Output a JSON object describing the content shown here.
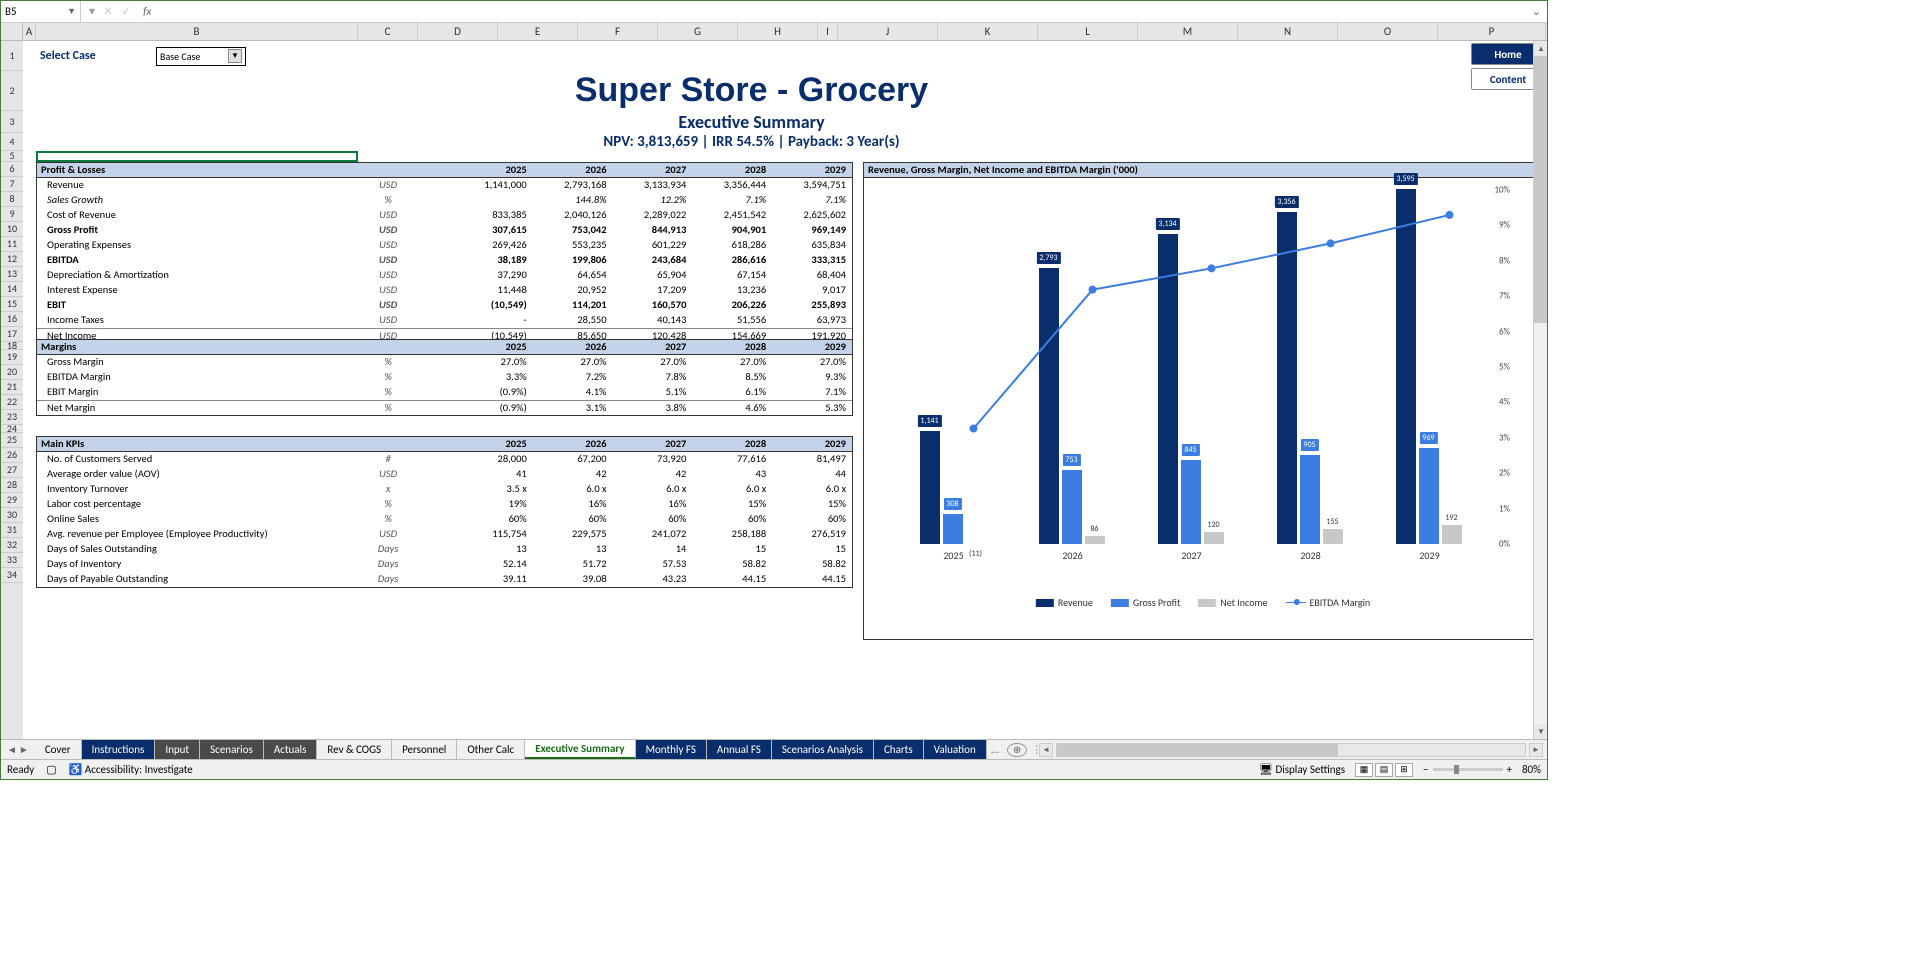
{
  "name_box": "B5",
  "fx": "fx",
  "formula_value": "",
  "select_case": {
    "label": "Select Case",
    "value": "Base Case"
  },
  "nav": {
    "home": "Home",
    "content": "Content"
  },
  "title": {
    "main": "Super Store - Grocery",
    "sub": "Executive Summary",
    "metrics": "NPV: 3,813,659 | IRR 54.5% | Payback: 3 Year(s)"
  },
  "columns": [
    "A",
    "B",
    "C",
    "D",
    "E",
    "F",
    "G",
    "H",
    "I",
    "J",
    "K",
    "L",
    "M",
    "N",
    "O",
    "P"
  ],
  "row_nums": [
    "1",
    "2",
    "3",
    "4",
    "5",
    "6",
    "7",
    "8",
    "9",
    "10",
    "11",
    "12",
    "13",
    "14",
    "15",
    "16",
    "17",
    "18",
    "19",
    "20",
    "21",
    "22",
    "23",
    "24",
    "25",
    "26",
    "27",
    "28",
    "29",
    "30",
    "31",
    "32",
    "33",
    "34"
  ],
  "years": [
    "2025",
    "2026",
    "2027",
    "2028",
    "2029"
  ],
  "pl": {
    "header": "Profit & Losses",
    "rows": [
      {
        "label": "Revenue",
        "unit": "USD",
        "vals": [
          "1,141,000",
          "2,793,168",
          "3,133,934",
          "3,356,444",
          "3,594,751"
        ]
      },
      {
        "label": "Sales Growth",
        "unit": "%",
        "vals": [
          "",
          "144.8%",
          "12.2%",
          "7.1%",
          "7.1%"
        ],
        "italic": true
      },
      {
        "label": "Cost of Revenue",
        "unit": "USD",
        "vals": [
          "833,385",
          "2,040,126",
          "2,289,022",
          "2,451,542",
          "2,625,602"
        ]
      },
      {
        "label": "Gross Profit",
        "unit": "USD",
        "vals": [
          "307,615",
          "753,042",
          "844,913",
          "904,901",
          "969,149"
        ],
        "bold": true
      },
      {
        "label": "Operating Expenses",
        "unit": "USD",
        "vals": [
          "269,426",
          "553,235",
          "601,229",
          "618,286",
          "635,834"
        ]
      },
      {
        "label": "EBITDA",
        "unit": "USD",
        "vals": [
          "38,189",
          "199,806",
          "243,684",
          "286,616",
          "333,315"
        ],
        "bold": true
      },
      {
        "label": "Depreciation & Amortization",
        "unit": "USD",
        "vals": [
          "37,290",
          "64,654",
          "65,904",
          "67,154",
          "68,404"
        ]
      },
      {
        "label": "Interest Expense",
        "unit": "USD",
        "vals": [
          "11,448",
          "20,952",
          "17,209",
          "13,236",
          "9,017"
        ]
      },
      {
        "label": "EBIT",
        "unit": "USD",
        "vals": [
          "(10,549)",
          "114,201",
          "160,570",
          "206,226",
          "255,893"
        ],
        "bold": true
      },
      {
        "label": "Income Taxes",
        "unit": "USD",
        "vals": [
          "-",
          "28,550",
          "40,143",
          "51,556",
          "63,973"
        ]
      },
      {
        "label": "Net Income",
        "unit": "USD",
        "vals": [
          "(10,549)",
          "85,650",
          "120,428",
          "154,669",
          "191,920"
        ],
        "last": true
      }
    ]
  },
  "margins": {
    "header": "Margins",
    "rows": [
      {
        "label": "Gross Margin",
        "unit": "%",
        "vals": [
          "27.0%",
          "27.0%",
          "27.0%",
          "27.0%",
          "27.0%"
        ]
      },
      {
        "label": "EBITDA Margin",
        "unit": "%",
        "vals": [
          "3.3%",
          "7.2%",
          "7.8%",
          "8.5%",
          "9.3%"
        ]
      },
      {
        "label": "EBIT Margin",
        "unit": "%",
        "vals": [
          "(0.9%)",
          "4.1%",
          "5.1%",
          "6.1%",
          "7.1%"
        ]
      },
      {
        "label": "Net Margin",
        "unit": "%",
        "vals": [
          "(0.9%)",
          "3.1%",
          "3.8%",
          "4.6%",
          "5.3%"
        ],
        "last": true
      }
    ]
  },
  "kpis": {
    "header": "Main KPIs",
    "rows": [
      {
        "label": "No. of Customers Served",
        "unit": "#",
        "vals": [
          "28,000",
          "67,200",
          "73,920",
          "77,616",
          "81,497"
        ]
      },
      {
        "label": "Average order value (AOV)",
        "unit": "USD",
        "vals": [
          "41",
          "42",
          "42",
          "43",
          "44"
        ]
      },
      {
        "label": "Inventory Turnover",
        "unit": "x",
        "vals": [
          "3.5 x",
          "6.0 x",
          "6.0 x",
          "6.0 x",
          "6.0 x"
        ]
      },
      {
        "label": "Labor cost percentage",
        "unit": "%",
        "vals": [
          "19%",
          "16%",
          "16%",
          "15%",
          "15%"
        ]
      },
      {
        "label": "Online Sales",
        "unit": "%",
        "vals": [
          "60%",
          "60%",
          "60%",
          "60%",
          "60%"
        ]
      },
      {
        "label": "Avg. revenue per Employee (Employee Productivity)",
        "unit": "USD",
        "vals": [
          "115,754",
          "229,575",
          "241,072",
          "258,188",
          "276,519"
        ]
      },
      {
        "label": "Days of Sales Outstanding",
        "unit": "Days",
        "vals": [
          "13",
          "13",
          "14",
          "15",
          "15"
        ]
      },
      {
        "label": "Days of Inventory",
        "unit": "Days",
        "vals": [
          "52.14",
          "51.72",
          "57.53",
          "58.82",
          "58.82"
        ]
      },
      {
        "label": "Days of Payable Outstanding",
        "unit": "Days",
        "vals": [
          "39.11",
          "39.08",
          "43.23",
          "44.15",
          "44.15"
        ]
      }
    ]
  },
  "chart": {
    "title": "Revenue, Gross Margin, Net Income and EBITDA Margin ('000)",
    "y2_label": "EBITDA Margin",
    "y2_ticks": [
      "10%",
      "9%",
      "8%",
      "7%",
      "6%",
      "5%",
      "4%",
      "3%",
      "2%",
      "1%",
      "0%"
    ],
    "x": [
      "2025",
      "2026",
      "2027",
      "2028",
      "2029"
    ],
    "legend": [
      "Revenue",
      "Gross Profit",
      "Net Income",
      "EBITDA Margin"
    ],
    "bar_labels": {
      "rev": [
        "1,141",
        "2,793",
        "3,134",
        "3,356",
        "3,595"
      ],
      "gp": [
        "308",
        "753",
        "845",
        "905",
        "969"
      ],
      "ni": [
        "(11)",
        "86",
        "120",
        "155",
        "192"
      ]
    }
  },
  "chart_data": {
    "type": "bar",
    "title": "Revenue, Gross Margin, Net Income and EBITDA Margin ('000)",
    "categories": [
      "2025",
      "2026",
      "2027",
      "2028",
      "2029"
    ],
    "series": [
      {
        "name": "Revenue",
        "values": [
          1141,
          2793,
          3134,
          3356,
          3595
        ],
        "axis": "y1"
      },
      {
        "name": "Gross Profit",
        "values": [
          308,
          753,
          845,
          905,
          969
        ],
        "axis": "y1"
      },
      {
        "name": "Net Income",
        "values": [
          -11,
          86,
          120,
          155,
          192
        ],
        "axis": "y1"
      },
      {
        "name": "EBITDA Margin",
        "values": [
          3.3,
          7.2,
          7.8,
          8.5,
          9.3
        ],
        "type": "line",
        "axis": "y2",
        "unit": "%"
      }
    ],
    "y2label": "EBITDA Margin",
    "y2lim": [
      0,
      10
    ],
    "y1lim": [
      0,
      3600
    ]
  },
  "sheet_tabs": [
    {
      "name": "Cover",
      "cls": ""
    },
    {
      "name": "Instructions",
      "cls": "blue"
    },
    {
      "name": "Input",
      "cls": "dark"
    },
    {
      "name": "Scenarios",
      "cls": "dark"
    },
    {
      "name": "Actuals",
      "cls": "dark"
    },
    {
      "name": "Rev & COGS",
      "cls": ""
    },
    {
      "name": "Personnel",
      "cls": ""
    },
    {
      "name": "Other Calc",
      "cls": ""
    },
    {
      "name": "Executive Summary",
      "cls": "active"
    },
    {
      "name": "Monthly FS",
      "cls": "blue"
    },
    {
      "name": "Annual FS",
      "cls": "blue"
    },
    {
      "name": "Scenarios Analysis",
      "cls": "blue"
    },
    {
      "name": "Charts",
      "cls": "blue"
    },
    {
      "name": "Valuation",
      "cls": "blue"
    }
  ],
  "tab_ellipsis": "...",
  "status": {
    "ready": "Ready",
    "accessibility": "Accessibility: Investigate",
    "display": "Display Settings",
    "zoom": "80%"
  }
}
